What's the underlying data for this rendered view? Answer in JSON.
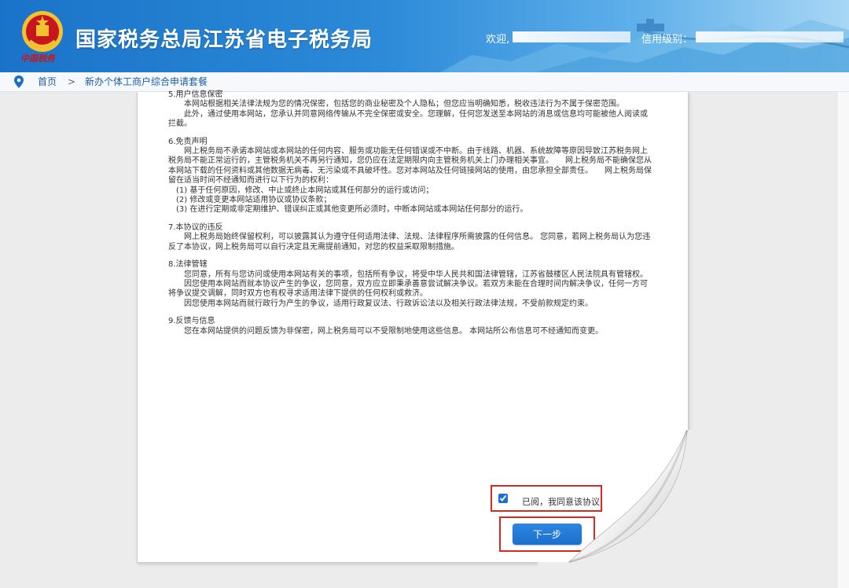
{
  "header": {
    "title": "国家税务总局江苏省电子税务局",
    "emblem_text": "中国税务",
    "welcome_label": "欢迎,",
    "credit_label": "信用级别："
  },
  "breadcrumb": {
    "home": "首页",
    "separator": ">",
    "current": "新办个体工商户综合申请套餐"
  },
  "agreement": {
    "sections": [
      {
        "title": "5.用户信息保密",
        "paragraphs": [
          "　　本网站根据相关法律法规为您的情况保密，包括您的商业秘密及个人隐私；但您应当明确知悉，税收违法行为不属于保密范围。",
          "　　此外，通过使用本网站，您承认并同意网络传输从不完全保密或安全。您理解，任何您发送至本网站的消息或信息均可能被他人阅读或拦截。"
        ]
      },
      {
        "title": "6.免责声明",
        "paragraphs": [
          "　　网上税务局不承诺本网站或本网站的任何内容、服务或功能无任何错误或不中断。由于线路、机器、系统故障等原因导致江苏税务网上税务局不能正常运行的，主管税务机关不再另行通知，您仍应在法定期限内向主管税务机关上门办理相关事宜。　　网上税务局不能确保您从本网站下载的任何资料或其他数据无病毒、无污染或不具破坏性。您对本网站及任何链接网站的使用，由您承担全部责任。　　网上税务局保留在适当时间不经通知而进行以下行为的权利：",
          "　(1) 基于任何原因，修改、中止或终止本网站或其任何部分的运行或访问；",
          "　(2) 修改或变更本网站适用协议或协议条款；",
          "　(3) 在进行定期或非定期维护、错误纠正或其他变更所必须时，中断本网站或本网站任何部分的运行。"
        ]
      },
      {
        "title": "7.本协议的违反",
        "paragraphs": [
          "　　网上税务局始终保留权利，可以披露其认为遵守任何适用法律、法规、法律程序所需披露的任何信息。 您同意，若网上税务局认为您违反了本协议，网上税务局可以自行决定且无需提前通知，对您的权益采取限制措施。"
        ]
      },
      {
        "title": "8.法律管辖",
        "paragraphs": [
          "　　您同意，所有与您访问或使用本网站有关的事项，包括所有争议，将受中华人民共和国法律管辖，江苏省鼓楼区人民法院具有管辖权。",
          "　　因您使用本网站而就本协议产生的争议，您同意，双方应立即秉承善意尝试解决争议。若双方未能在合理时间内解决争议，任何一方可将争议提交调解，同时双方也有权寻求适用法律下提供的任何权利或救济。",
          "　　因您使用本网站而就行政行为产生的争议，适用行政复议法、行政诉讼法以及相关行政法律法规，不受前款规定约束。"
        ]
      },
      {
        "title": "9.反馈与信息",
        "paragraphs": [
          "　　您在本网站提供的问题反馈为非保密，网上税务局可以不受限制地使用这些信息。 本网站所公布信息可不经通知而变更。"
        ]
      }
    ],
    "agree_label": "已阅，我同意该协议",
    "agree_checked": true,
    "next_label": "下一步"
  },
  "colors": {
    "header_blue": "#1a73c8",
    "link_blue": "#1a5fa8",
    "button_blue": "#1a6fcc",
    "highlight_red": "#d9281e",
    "emblem_red": "#c8161d"
  }
}
